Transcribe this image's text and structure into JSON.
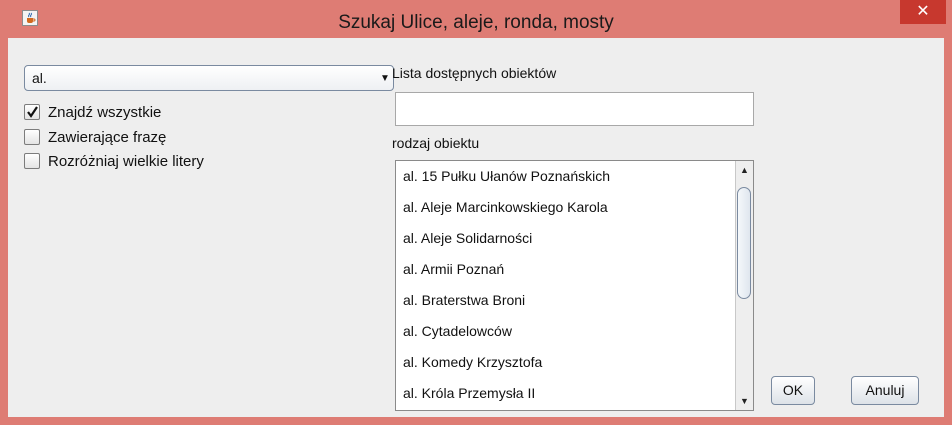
{
  "window": {
    "title": "Szukaj Ulice, aleje, ronda, mosty",
    "close_glyph": "✕"
  },
  "combo": {
    "value": "al.",
    "arrow": "▼"
  },
  "checkboxes": [
    {
      "label": "Znajdź wszystkie",
      "checked": true
    },
    {
      "label": "Zawierające frazę",
      "checked": false
    },
    {
      "label": "Rozróżniaj wielkie litery",
      "checked": false
    }
  ],
  "labels": {
    "available_objects": "Lista dostępnych obiektów",
    "object_type": "rodzaj obiektu"
  },
  "search_field": {
    "value": ""
  },
  "list": {
    "items": [
      "al. 15 Pułku Ułanów Poznańskich",
      "al. Aleje Marcinkowskiego Karola",
      "al. Aleje Solidarności",
      "al. Armii Poznań",
      "al. Braterstwa Broni",
      "al. Cytadelowców",
      "al. Komedy Krzysztofa",
      "al. Króla Przemysła II"
    ]
  },
  "scrollbar": {
    "up": "▲",
    "down": "▼"
  },
  "buttons": {
    "ok": "OK",
    "cancel": "Anuluj"
  },
  "colors": {
    "title_bar": "#de7c74",
    "close": "#c7382e",
    "client": "#eeeeee"
  },
  "icons": {
    "app": "java-cup-icon",
    "check": "checkmark-icon"
  }
}
